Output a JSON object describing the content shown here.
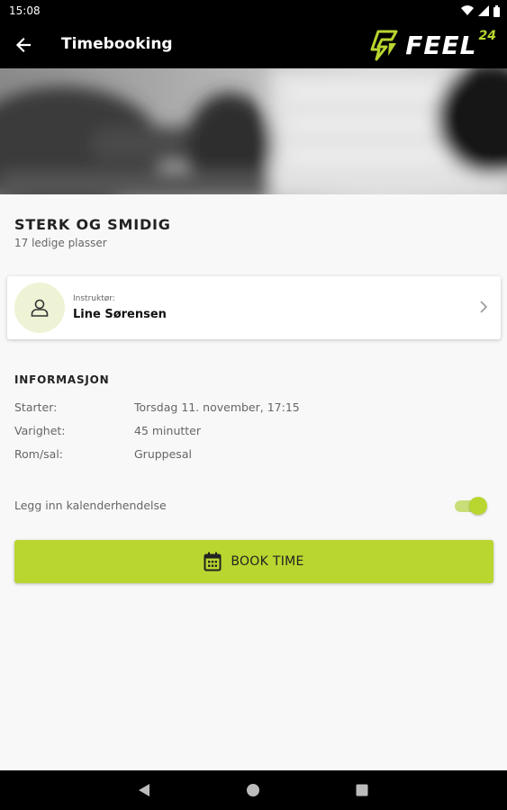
{
  "status_bar": {
    "time": "15:08",
    "icons": [
      "wifi-icon",
      "signal-icon",
      "battery-icon"
    ]
  },
  "app_bar": {
    "title": "Timebooking",
    "back_icon": "arrow-left-icon",
    "logo": {
      "text": "FEEL",
      "superscript": "24",
      "accent_color": "#b8d62f"
    }
  },
  "class": {
    "title": "STERK OG SMIDIG",
    "available_spots": "17 ledige plasser"
  },
  "instructor": {
    "label": "Instruktør:",
    "name": "Line Sørensen",
    "icon": "person-icon"
  },
  "info": {
    "heading": "INFORMASJON",
    "rows": [
      {
        "key": "Starter:",
        "value": "Torsdag 11. november, 17:15"
      },
      {
        "key": "Varighet:",
        "value": "45 minutter"
      },
      {
        "key": "Rom/sal:",
        "value": "Gruppesal"
      }
    ]
  },
  "calendar_toggle": {
    "label": "Legg inn kalenderhendelse",
    "enabled": true
  },
  "book_button": {
    "label": "BOOK TIME",
    "icon": "calendar-icon"
  },
  "colors": {
    "accent": "#b8d62f",
    "bar_background": "#000000",
    "page_background": "#f8f8f8"
  },
  "nav_bar": {
    "icons": [
      "back-triangle-icon",
      "home-circle-icon",
      "recents-square-icon"
    ]
  }
}
